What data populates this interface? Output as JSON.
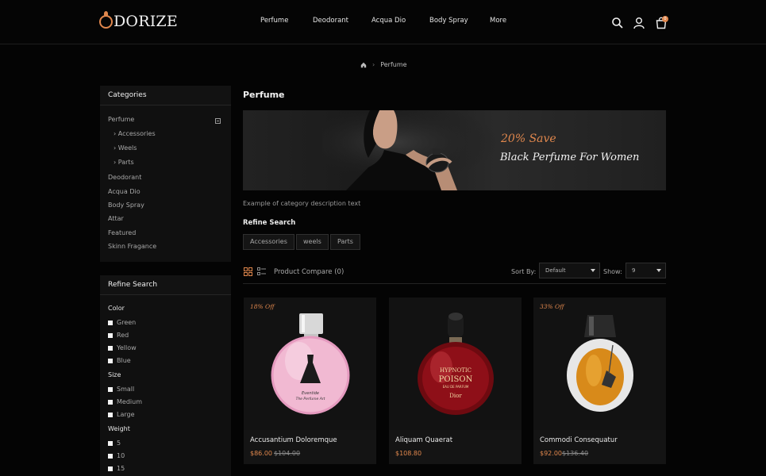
{
  "brand": {
    "logo_text": "DORIZE",
    "accent_color": "#e0874d"
  },
  "nav": {
    "items": [
      "Perfume",
      "Deodorant",
      "Acqua Dio",
      "Body Spray",
      "More"
    ]
  },
  "header_icons": [
    "search-icon",
    "user-icon",
    "shopping-bag-icon"
  ],
  "cart": {
    "count": "0"
  },
  "breadcrumb": {
    "home_icon": "home-icon",
    "current": "Perfume",
    "separator": "›"
  },
  "categories": {
    "title": "Categories",
    "items": [
      {
        "label": "Perfume",
        "expanded": true,
        "children": [
          "Accessories",
          "Weels",
          "Parts"
        ]
      },
      {
        "label": "Deodorant"
      },
      {
        "label": "Acqua Dio"
      },
      {
        "label": "Body Spray"
      },
      {
        "label": "Attar"
      },
      {
        "label": "Featured"
      },
      {
        "label": "Skinn Fragance"
      }
    ]
  },
  "filters": {
    "title": "Refine Search",
    "groups": [
      {
        "name": "Color",
        "options": [
          "Green",
          "Red",
          "Yellow",
          "Blue"
        ]
      },
      {
        "name": "Size",
        "options": [
          "Small",
          "Medium",
          "Large"
        ]
      },
      {
        "name": "Weight",
        "options": [
          "5",
          "10",
          "15"
        ]
      }
    ]
  },
  "main": {
    "title": "Perfume",
    "banner": {
      "save": "20% Save",
      "text": "Black Perfume For Women"
    },
    "description": "Example of category description text",
    "refine_title": "Refine Search",
    "refine_tags": [
      "Accessories",
      "weels",
      "Parts"
    ],
    "toolbar": {
      "compare": "Product Compare (0)",
      "sort_label": "Sort By:",
      "sort_value": "Default",
      "show_label": "Show:",
      "show_value": "9"
    }
  },
  "products": [
    {
      "name": "Accusantium Doloremque",
      "price": "$86.00",
      "old_price": "$104.00",
      "discount": "18% Off",
      "bottle_color": "#f0b8d0"
    },
    {
      "name": "Aliquam Quaerat",
      "price": "$108.80",
      "old_price": "",
      "discount": "",
      "bottle_color": "#8a0d14"
    },
    {
      "name": "Commodi Consequatur",
      "price": "$92.00",
      "old_price": "$136.40",
      "discount": "33% Off",
      "bottle_color": "#d88a1a"
    }
  ],
  "bottle_label": {
    "line1": "Eventide",
    "line2": "The Perfume Art",
    "hypnotic": "HYPNOTIC",
    "poison": "POISON",
    "sub": "EAU DE PARFUM",
    "brand": "Dior"
  }
}
